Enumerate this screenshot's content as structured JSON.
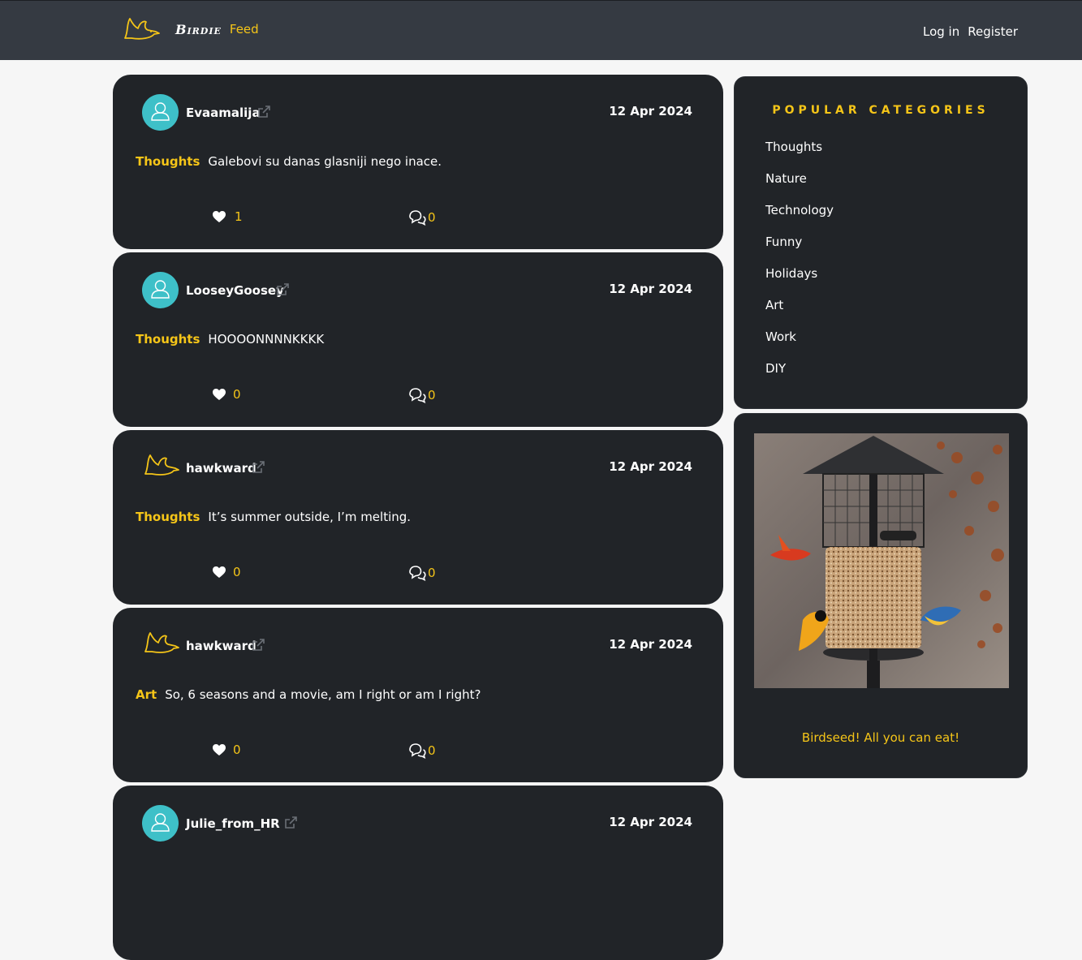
{
  "header": {
    "brand": "Birdie",
    "section": "Feed",
    "login": "Log in",
    "register": "Register"
  },
  "posts": [
    {
      "user": "Evaamalija",
      "avatar": "person-avatar",
      "date": "12 Apr 2024",
      "category": "Thoughts",
      "text": "Galebovi su danas glasniji nego inace.",
      "likes": "1",
      "comments": "0"
    },
    {
      "user": "LooseyGoosey",
      "avatar": "person-avatar",
      "date": "12 Apr 2024",
      "category": "Thoughts",
      "text": "HOOOONNNNKKKK",
      "likes": "0",
      "comments": "0"
    },
    {
      "user": "hawkward",
      "avatar": "bird-avatar",
      "date": "12 Apr 2024",
      "category": "Thoughts",
      "text": "It’s summer outside, I’m melting.",
      "likes": "0",
      "comments": "0"
    },
    {
      "user": "hawkward",
      "avatar": "bird-avatar",
      "date": "12 Apr 2024",
      "category": "Art",
      "text": "So, 6 seasons and a movie, am I right or am I right?",
      "likes": "0",
      "comments": "0"
    },
    {
      "user": "Julie_from_HR",
      "avatar": "person-avatar",
      "date": "12 Apr 2024",
      "category": "",
      "text": "",
      "likes": "",
      "comments": ""
    }
  ],
  "sidebar": {
    "title": "POPULAR CATEGORIES",
    "categories": [
      "Thoughts",
      "Nature",
      "Technology",
      "Funny",
      "Holidays",
      "Art",
      "Work",
      "DIY"
    ]
  },
  "ad": {
    "caption": "Birdseed! All you can eat!"
  },
  "colors": {
    "accent": "#f5c518",
    "card": "#212428",
    "header": "#353a42",
    "avatar": "#3ec0c8"
  }
}
